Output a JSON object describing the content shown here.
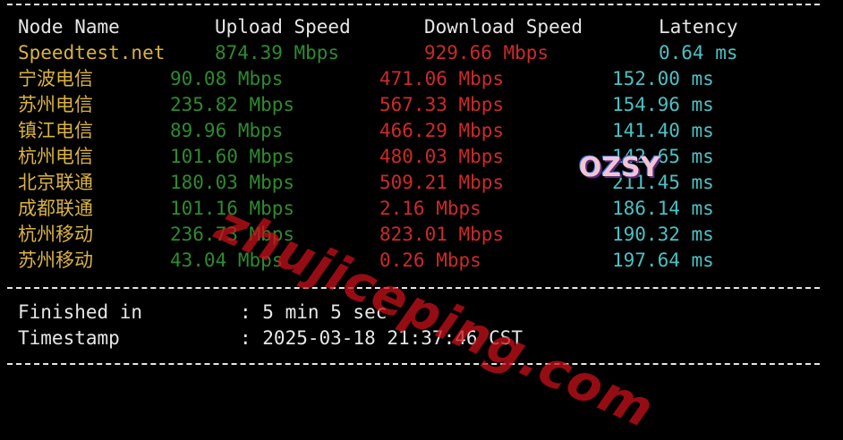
{
  "colors": {
    "background": "#000000",
    "header": "#e6e6e6",
    "node_default": "#d9b341",
    "upload": "#2e8b2e",
    "download": "#cc2a2a",
    "latency": "#4cc0c4",
    "summary": "#e6e6e6",
    "watermark": "#c8101a"
  },
  "header": {
    "node_name": "Node Name",
    "upload_speed": "Upload Speed",
    "download_speed": "Download Speed",
    "latency": "Latency"
  },
  "rows": [
    {
      "node": "Speedtest.net",
      "upload": "874.39 Mbps",
      "download": "929.66 Mbps",
      "latency": "0.64 ms"
    },
    {
      "node": "宁波电信",
      "upload": "90.08 Mbps",
      "download": "471.06 Mbps",
      "latency": "152.00 ms"
    },
    {
      "node": "苏州电信",
      "upload": "235.82 Mbps",
      "download": "567.33 Mbps",
      "latency": "154.96 ms"
    },
    {
      "node": "镇江电信",
      "upload": "89.96 Mbps",
      "download": "466.29 Mbps",
      "latency": "141.40 ms"
    },
    {
      "node": "杭州电信",
      "upload": "101.60 Mbps",
      "download": "480.03 Mbps",
      "latency": "142.65 ms"
    },
    {
      "node": "北京联通",
      "upload": "180.03 Mbps",
      "download": "509.21 Mbps",
      "latency": "211.45 ms"
    },
    {
      "node": "成都联通",
      "upload": "101.16 Mbps",
      "download": "2.16 Mbps",
      "latency": "186.14 ms"
    },
    {
      "node": "杭州移动",
      "upload": "236.73 Mbps",
      "download": "823.01 Mbps",
      "latency": "190.32 ms"
    },
    {
      "node": "苏州移动",
      "upload": "43.04 Mbps",
      "download": "0.26 Mbps",
      "latency": "197.64 ms"
    }
  ],
  "summary": {
    "finished_label": "Finished in",
    "finished_value": ": 5 min 5 sec",
    "timestamp_label": "Timestamp",
    "timestamp_value": ": 2025-03-18 21:37:46 CST"
  },
  "watermark": {
    "text": "zhujiceping.com"
  },
  "logo": {
    "text": "OZSY"
  }
}
